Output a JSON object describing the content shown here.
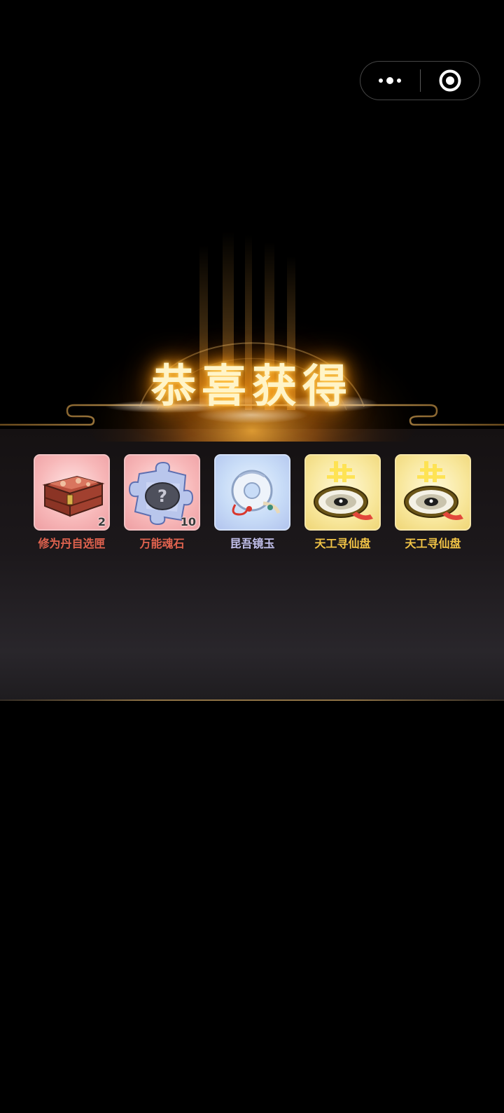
{
  "title": "恭喜获得",
  "capsule": {
    "menu_icon": "more-dots-icon",
    "close_icon": "target-circle-icon"
  },
  "colors": {
    "label_pink": "#e0624e",
    "label_blue": "#c2c0ec",
    "label_gold": "#f2c446",
    "title_glow": "#ffb02a"
  },
  "items": [
    {
      "name": "修为丹自选匣",
      "count": "2",
      "icon": "treasure-chest-icon",
      "rarity": "pink"
    },
    {
      "name": "万能魂石",
      "count": "10",
      "icon": "soul-stone-puzzle-icon",
      "rarity": "pink"
    },
    {
      "name": "昆吾镜玉",
      "count": "",
      "icon": "jade-disc-icon",
      "rarity": "blue"
    },
    {
      "name": "天工寻仙盘",
      "count": "",
      "icon": "compass-disc-icon",
      "rarity": "gold"
    },
    {
      "name": "天工寻仙盘",
      "count": "",
      "icon": "compass-disc-icon",
      "rarity": "gold"
    }
  ]
}
